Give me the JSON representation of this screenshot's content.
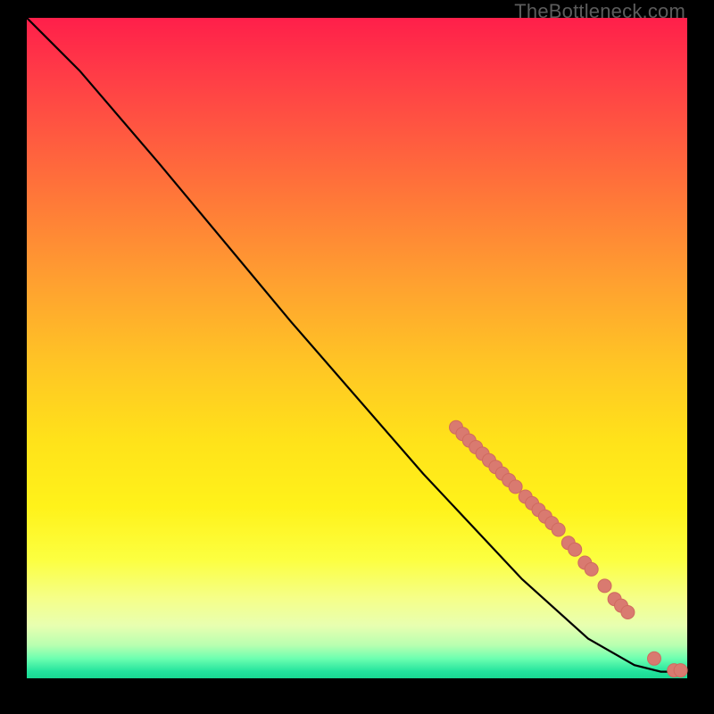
{
  "watermark": "TheBottleneck.com",
  "chart_data": {
    "type": "line",
    "title": "",
    "xlabel": "",
    "ylabel": "",
    "xlim": [
      0,
      100
    ],
    "ylim": [
      0,
      100
    ],
    "background_gradient": {
      "top": "#ff1f4a",
      "upper_mid": "#ff7a38",
      "mid": "#ffe21a",
      "lower_mid": "#f5ff8a",
      "bottom": "#19d892"
    },
    "series": [
      {
        "name": "curve",
        "type": "line",
        "color": "#000000",
        "x": [
          0,
          3,
          8,
          20,
          40,
          60,
          75,
          85,
          92,
          96,
          100
        ],
        "y": [
          100,
          97,
          92,
          78,
          54,
          31,
          15,
          6,
          2,
          1,
          1
        ]
      },
      {
        "name": "markers",
        "type": "scatter",
        "color": "#d97a70",
        "x": [
          65,
          66,
          67,
          68,
          69,
          70,
          71,
          72,
          73,
          74,
          75.5,
          76.5,
          77.5,
          78.5,
          79.5,
          80.5,
          82,
          83,
          84.5,
          85.5,
          87.5,
          89,
          90,
          91,
          95,
          98,
          99
        ],
        "y": [
          38,
          37,
          36,
          35,
          34,
          33,
          32,
          31,
          30,
          29,
          27.5,
          26.5,
          25.5,
          24.5,
          23.5,
          22.5,
          20.5,
          19.5,
          17.5,
          16.5,
          14,
          12,
          11,
          10,
          3,
          1.2,
          1.2
        ]
      }
    ]
  }
}
